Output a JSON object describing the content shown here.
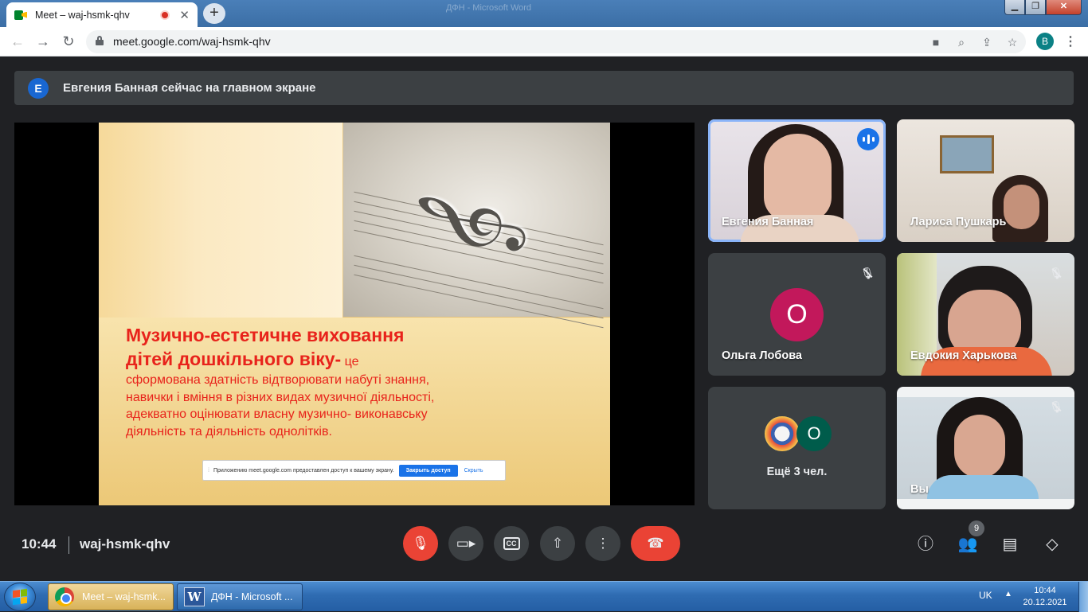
{
  "browser": {
    "tab_title": "Meet – waj-hsmk-qhv",
    "background_window_title": "ДФН - Microsoft Word",
    "url": "meet.google.com/waj-hsmk-qhv",
    "profile_initial": "B",
    "icons": [
      "back-arrow-icon",
      "forward-arrow-icon",
      "reload-icon",
      "lock-icon",
      "camera-icon",
      "zoom-icon",
      "share-icon",
      "star-icon",
      "more-vert-icon"
    ]
  },
  "meet": {
    "banner": {
      "avatar_letter": "E",
      "text": "Евгения Банная сейчас на главном экране"
    },
    "slide": {
      "heading_line1": "Музично-естетичне виховання",
      "heading_line2": "дітей дошкільного віку-",
      "heading_tail": " це",
      "body": "сформована здатність відтворювати набуті знання, навички і вміння в різних видах музичної діяльності, адекватно оцінювати власну музично- виконавську діяльність та діяльність однолітків."
    },
    "share_notice": {
      "text": "Приложению meet.google.com предоставлен доступ к вашему экрану.",
      "stop_label": "Закрыть доступ",
      "hide_label": "Скрыть"
    },
    "participants": [
      {
        "name": "Евгения Банная",
        "speaking": true
      },
      {
        "name": "Лариса Пушкарь",
        "muted": false
      },
      {
        "name": "Ольга Лобова",
        "avatar_letter": "О",
        "muted": true,
        "avatar_color": "#c2185b"
      },
      {
        "name": "Евдокия Харькова",
        "muted": true
      },
      {
        "name": "Вы",
        "muted": true
      }
    ],
    "more_tile": {
      "label": "Ещё 3 чел.",
      "avatar_letter": "О",
      "avatar_color": "#005c4b"
    },
    "controls": {
      "time": "10:44",
      "meeting_code": "waj-hsmk-qhv",
      "people_count": "9",
      "cc_label": "CC"
    }
  },
  "taskbar": {
    "chrome_task": "Meet – waj-hsmk...",
    "word_task": "ДФН - Microsoft ...",
    "language": "UK",
    "time": "10:44",
    "date": "20.12.2021"
  },
  "colors": {
    "meet_bg": "#202124",
    "leave_red": "#ea4335",
    "slide_text_red": "#e8231b"
  }
}
